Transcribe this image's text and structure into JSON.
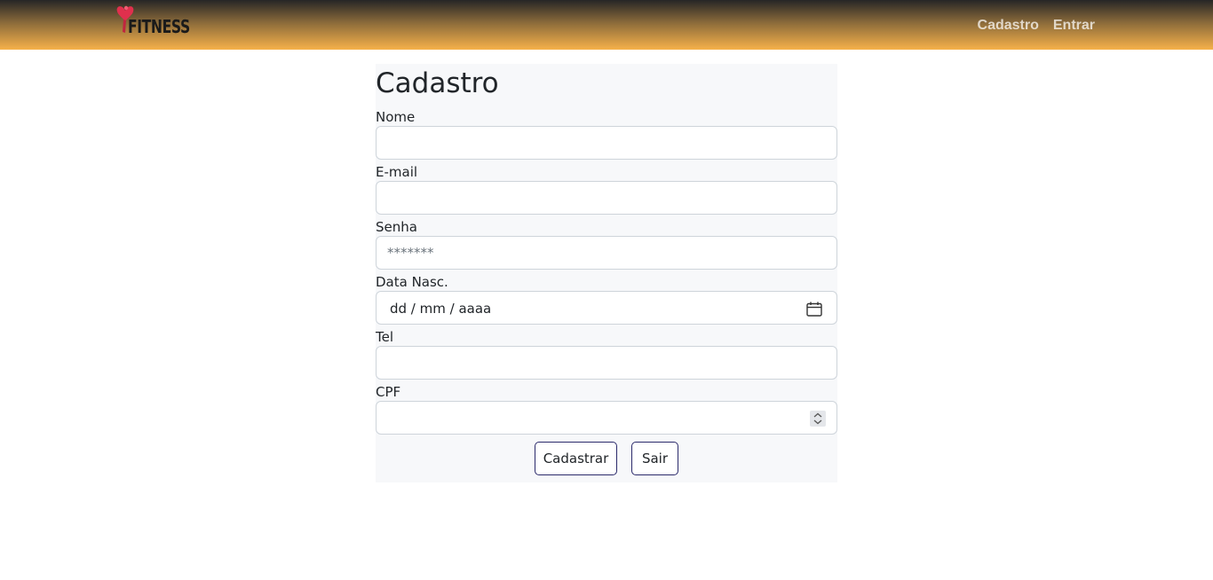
{
  "header": {
    "brand_text": "FITNESS",
    "nav": [
      {
        "label": "Cadastro"
      },
      {
        "label": "Entrar"
      }
    ]
  },
  "form": {
    "title": "Cadastro",
    "fields": {
      "nome": {
        "label": "Nome",
        "value": ""
      },
      "email": {
        "label": "E-mail",
        "value": ""
      },
      "senha": {
        "label": "Senha",
        "placeholder": "*******"
      },
      "data_nasc": {
        "label": "Data Nasc.",
        "placeholder": "dd / mm / aaaa"
      },
      "tel": {
        "label": "Tel",
        "value": ""
      },
      "cpf": {
        "label": "CPF",
        "value": ""
      }
    },
    "buttons": {
      "submit": "Cadastrar",
      "exit": "Sair"
    }
  },
  "colors": {
    "header_gradient_top": "#262626",
    "header_gradient_bottom": "#f6b14a",
    "button_border": "#2b2a6b",
    "logo_heart": "#e0304d"
  }
}
